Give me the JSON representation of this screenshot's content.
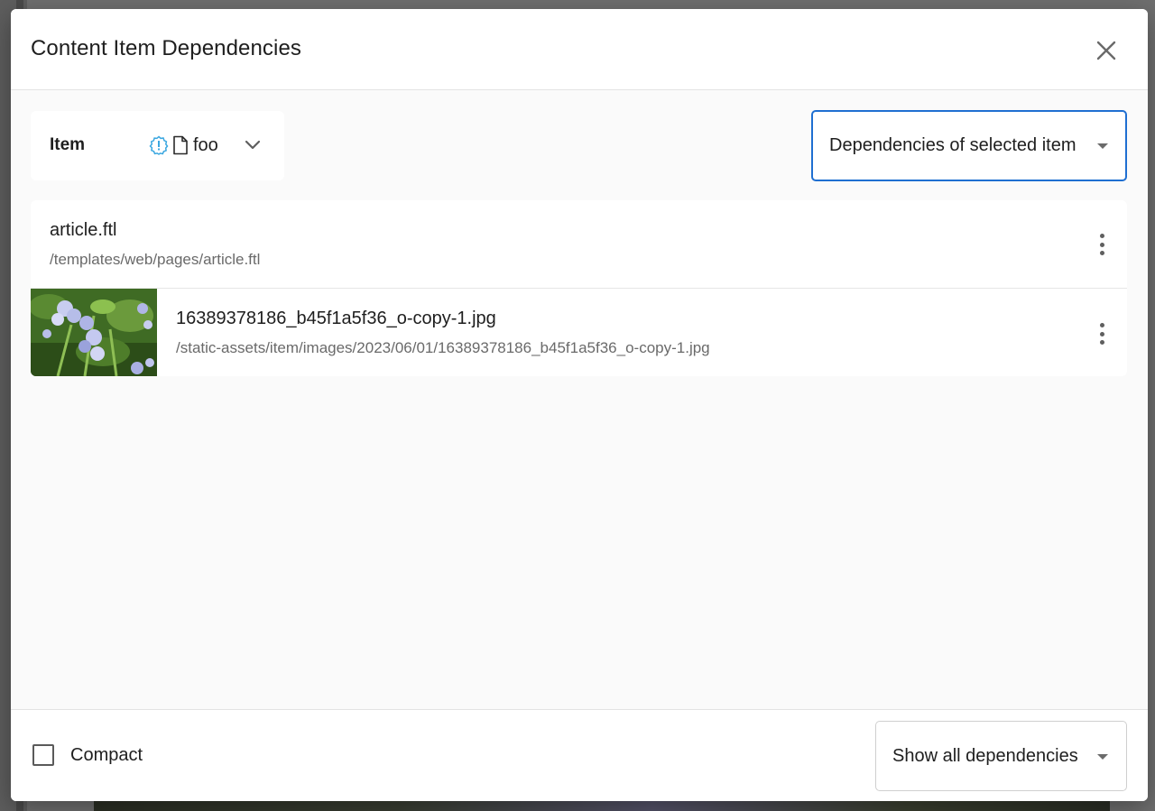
{
  "dialog": {
    "title": "Content Item Dependencies",
    "close_icon": "close-icon"
  },
  "item_picker": {
    "label": "Item",
    "status_icon": "warning-badge-icon",
    "type_icon": "file-icon",
    "selected_item": "foo",
    "dropdown_icon": "chevron-down-icon"
  },
  "mode_select": {
    "value": "Dependencies of selected item",
    "accent_color": "#1f6fd1"
  },
  "dependencies": [
    {
      "name": "article.ftl",
      "path": "/templates/web/pages/article.ftl",
      "has_thumbnail": false,
      "menu_icon": "more-vertical-icon"
    },
    {
      "name": "16389378186_b45f1a5f36_o-copy-1.jpg",
      "path": "/static-assets/item/images/2023/06/01/16389378186_b45f1a5f36_o-copy-1.jpg",
      "has_thumbnail": true,
      "thumbnail_description": "flowers",
      "menu_icon": "more-vertical-icon"
    }
  ],
  "footer": {
    "compact_label": "Compact",
    "compact_checked": false,
    "show_select_value": "Show all dependencies"
  }
}
